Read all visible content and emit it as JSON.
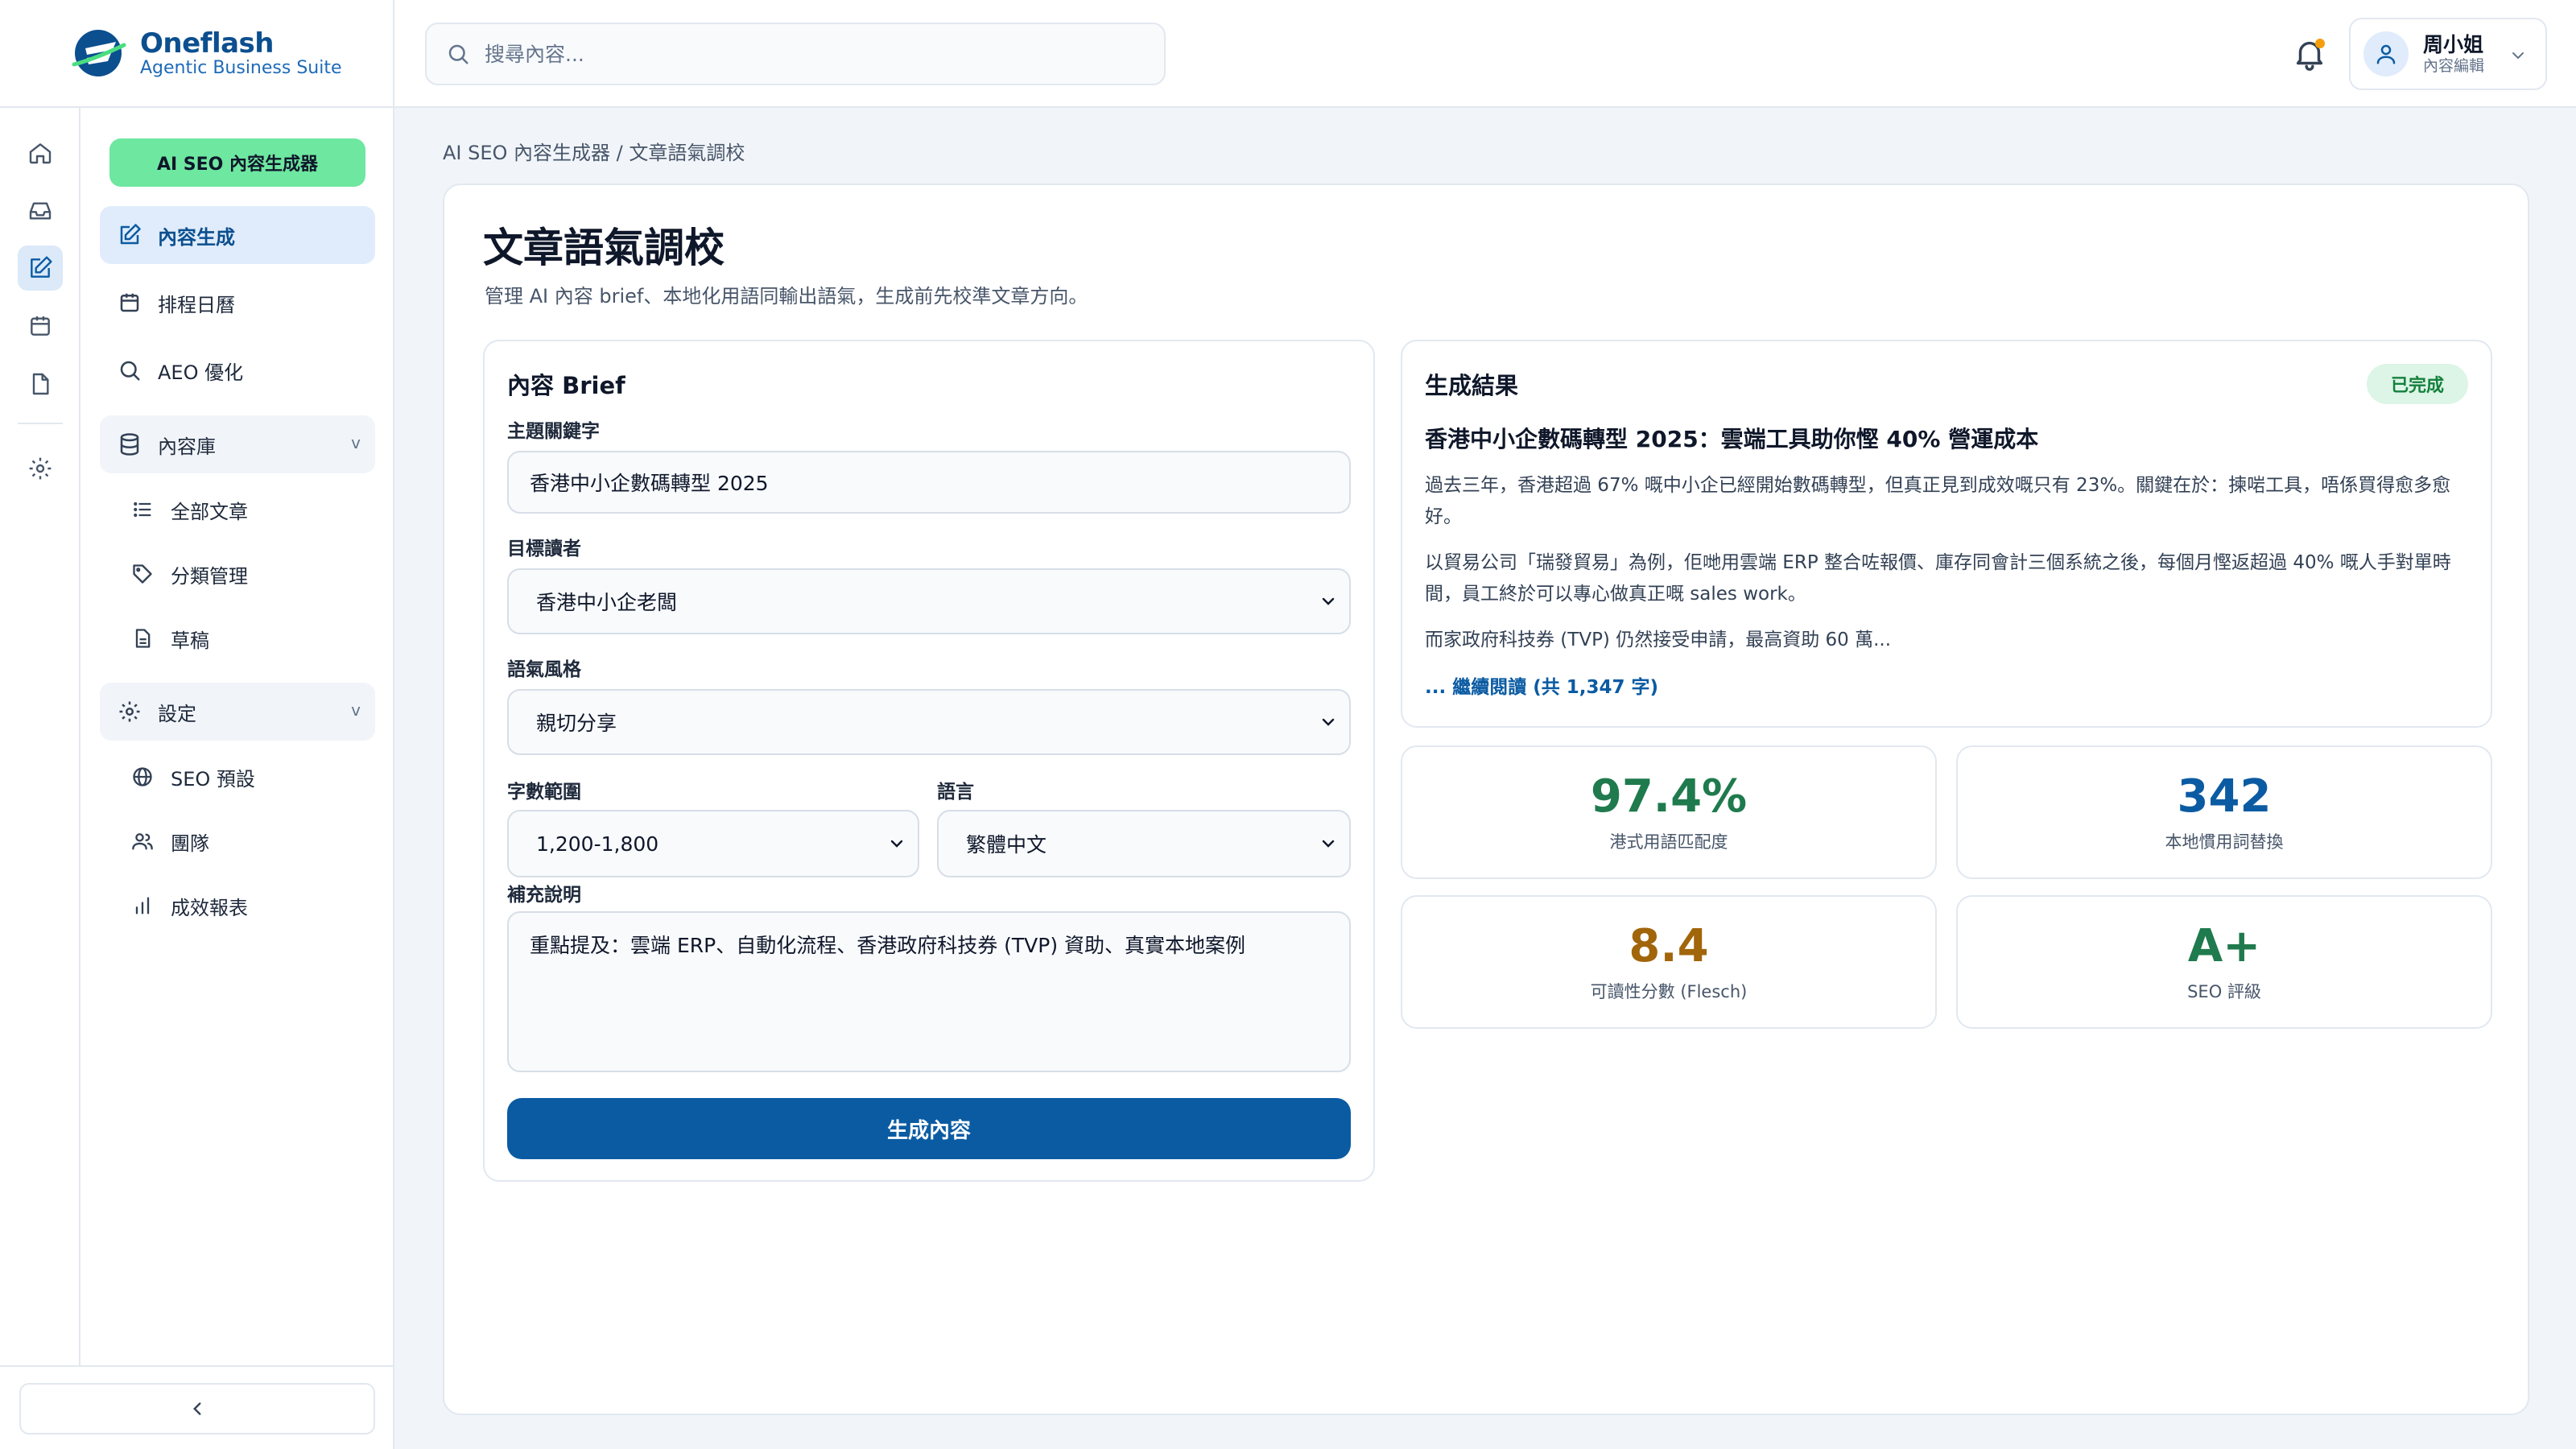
{
  "app": {
    "name": "Oneflash",
    "tagline": "Agentic Business Suite"
  },
  "search": {
    "placeholder": "搜尋內容..."
  },
  "user": {
    "name": "周小姐",
    "role": "內容編輯"
  },
  "sidebar": {
    "brand_button": "AI SEO 內容生成器",
    "items": {
      "content_gen": "內容生成",
      "schedule": "排程日曆",
      "aeo": "AEO 優化",
      "library": "內容庫",
      "all_articles": "全部文章",
      "categories": "分類管理",
      "drafts": "草稿",
      "settings": "設定",
      "seo_presets": "SEO 預設",
      "team": "團隊",
      "reports": "成效報表"
    },
    "caret": "v"
  },
  "breadcrumb": "AI SEO 內容生成器 / 文章語氣調校",
  "page": {
    "title": "文章語氣調校",
    "subtitle": "管理 AI 內容 brief、本地化用語同輸出語氣，生成前先校準文章方向。"
  },
  "brief": {
    "title": "內容 Brief",
    "keyword_label": "主題關鍵字",
    "keyword_value": "香港中小企數碼轉型 2025",
    "audience_label": "目標讀者",
    "audience_value": "香港中小企老闆",
    "tone_label": "語氣風格",
    "tone_value": "親切分享",
    "length_label": "字數範圍",
    "length_value": "1,200-1,800",
    "language_label": "語言",
    "language_value": "繁體中文",
    "notes_label": "補充說明",
    "notes_value": "重點提及：雲端 ERP、自動化流程、香港政府科技券 (TVP) 資助、真實本地案例",
    "generate_button": "生成內容"
  },
  "result": {
    "title": "生成結果",
    "status": "已完成",
    "article_title": "香港中小企數碼轉型 2025：雲端工具助你慳 40% 營運成本",
    "paragraphs": [
      "過去三年，香港超過 67% 嘅中小企已經開始數碼轉型，但真正見到成效嘅只有 23%。關鍵在於：揀啱工具，唔係買得愈多愈好。",
      "以貿易公司「瑞發貿易」為例，佢哋用雲端 ERP 整合咗報價、庫存同會計三個系統之後，每個月慳返超過 40% 嘅人手對單時間，員工終於可以專心做真正嘅 sales work。",
      "而家政府科技券 (TVP) 仍然接受申請，最高資助 60 萬..."
    ],
    "read_more": "... 繼續閱讀 (共 1,347 字)"
  },
  "stats": [
    {
      "value": "97.4%",
      "label": "港式用語匹配度",
      "color": "#1f7a4d"
    },
    {
      "value": "342",
      "label": "本地慣用詞替換",
      "color": "#0b5ba3"
    },
    {
      "value": "8.4",
      "label": "可讀性分數 (Flesch)",
      "color": "#a1650a"
    },
    {
      "value": "A+",
      "label": "SEO 評級",
      "color": "#1f7a4d"
    }
  ],
  "colors": {
    "accent": "#0b5ba3",
    "brand_green": "#6ee7a0",
    "active_nav_bg": "#e0ecfb",
    "success": "#15803d"
  },
  "icons": {
    "rail": [
      "home-icon",
      "inbox-icon",
      "edit-icon",
      "calendar-icon",
      "file-icon",
      "gear-icon"
    ],
    "topbar": [
      "search-icon",
      "bell-icon",
      "user-icon",
      "chevron-down-icon"
    ]
  }
}
